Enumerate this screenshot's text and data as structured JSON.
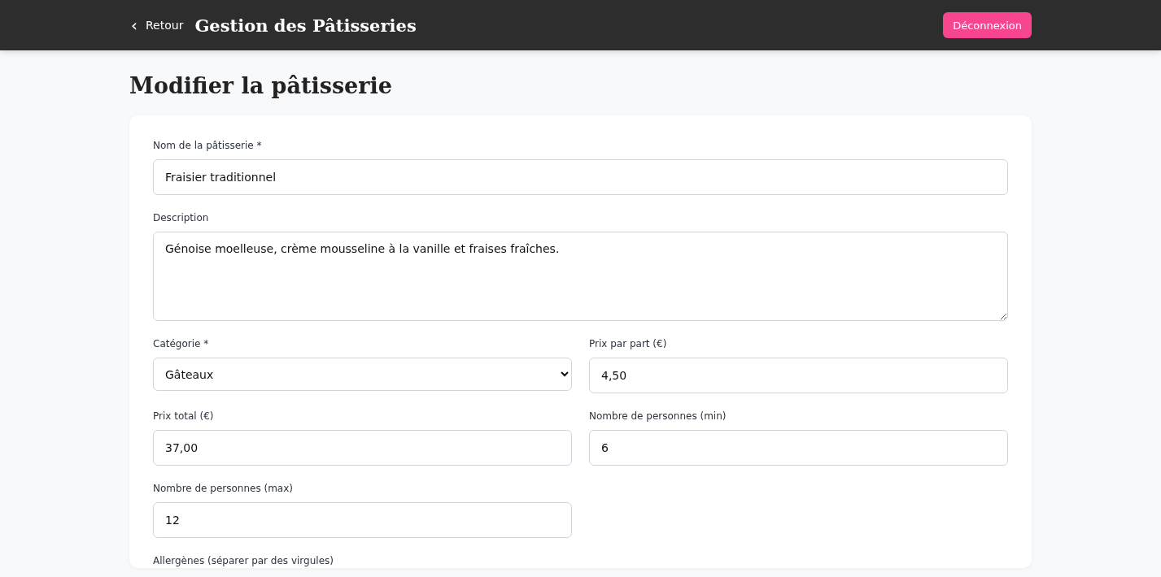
{
  "header": {
    "back": {
      "icon": "‹",
      "label": "Retour"
    },
    "title": "Gestion des Pâtisseries",
    "logout": "Déconnexion"
  },
  "page_title": "Modifier la pâtisserie",
  "form": {
    "rows": [
      [
        {
          "kind": "text",
          "label": "Nom de la pâtisserie *",
          "value": "Fraisier traditionnel"
        }
      ],
      [
        {
          "kind": "textarea",
          "label": "Description",
          "value": "Génoise moelleuse, crème mousseline à la vanille et fraises fraîches."
        }
      ],
      [
        {
          "kind": "select",
          "label": "Catégorie *",
          "value": "Gâteaux"
        },
        {
          "kind": "text",
          "label": "Prix par part (€)",
          "value": "4,50"
        }
      ],
      [
        {
          "kind": "text",
          "label": "Prix total (€)",
          "value": "37,00"
        },
        {
          "kind": "text",
          "label": "Nombre de personnes (min)",
          "value": "6"
        }
      ],
      [
        {
          "kind": "text",
          "label": "Nombre de personnes (max)",
          "value": "12"
        }
      ],
      [
        {
          "kind": "label",
          "label": "Allergènes (séparer par des virgules)"
        }
      ]
    ]
  }
}
